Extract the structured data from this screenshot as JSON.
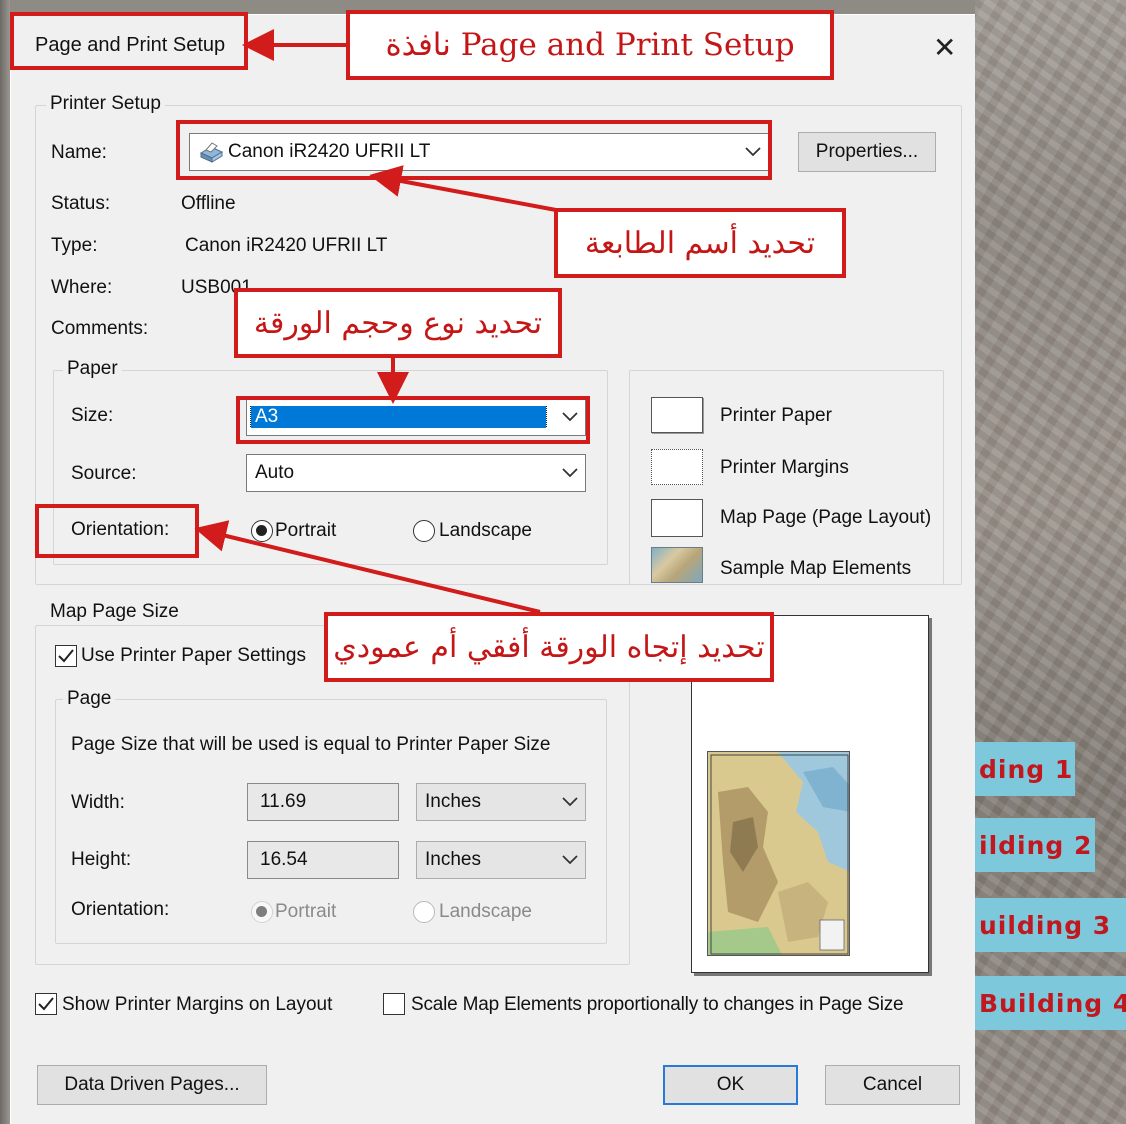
{
  "dialog": {
    "title": "Page and Print Setup",
    "close_glyph": "✕"
  },
  "printer_setup": {
    "group_title": "Printer Setup",
    "name_label": "Name:",
    "name_value": "Canon iR2420 UFRII LT",
    "properties_button": "Properties...",
    "status_label": "Status:",
    "status_value": "Offline",
    "type_label": "Type:",
    "type_value": "Canon iR2420 UFRII LT",
    "where_label": "Where:",
    "where_value": "USB001",
    "comments_label": "Comments:"
  },
  "paper": {
    "group_title": "Paper",
    "size_label": "Size:",
    "size_value": "A3",
    "source_label": "Source:",
    "source_value": "Auto",
    "orientation_label": "Orientation:",
    "portrait_label": "Portrait",
    "landscape_label": "Landscape",
    "selected_orientation": "Portrait"
  },
  "legend": {
    "printer_paper": "Printer Paper",
    "printer_margins": "Printer Margins",
    "map_page": "Map Page (Page Layout)",
    "sample_elements": "Sample Map Elements"
  },
  "map_page_size": {
    "group_title": "Map Page Size",
    "use_printer_settings_label": "Use Printer Paper Settings",
    "use_printer_settings_checked": true,
    "page_group_title": "Page",
    "info_text": "Page Size that will be used is equal to Printer Paper Size",
    "width_label": "Width:",
    "width_value": "11.69",
    "width_unit": "Inches",
    "height_label": "Height:",
    "height_value": "16.54",
    "height_unit": "Inches",
    "orientation_label": "Orientation:",
    "portrait_label": "Portrait",
    "landscape_label": "Landscape"
  },
  "options": {
    "show_margins_label": "Show Printer Margins on Layout",
    "show_margins_checked": true,
    "scale_elements_label": "Scale Map Elements proportionally to changes in Page Size",
    "scale_elements_checked": false
  },
  "buttons": {
    "data_driven_pages": "Data Driven Pages...",
    "ok": "OK",
    "cancel": "Cancel"
  },
  "annotations": {
    "window": "نافذة Page and Print Setup",
    "printer_name": "تحديد أسم الطابعة",
    "paper_type_size": "تحديد نوع وحجم الورقة",
    "orientation": "تحديد إتجاه الورقة أفقي أم عمودي"
  },
  "background_labels": [
    "ding 1",
    "ilding 2",
    "uilding 3",
    "Building 4"
  ],
  "colors": {
    "annotation_red": "#d21b1b",
    "selection_blue": "#0078d7",
    "dialog_bg": "#f0f0f0"
  }
}
